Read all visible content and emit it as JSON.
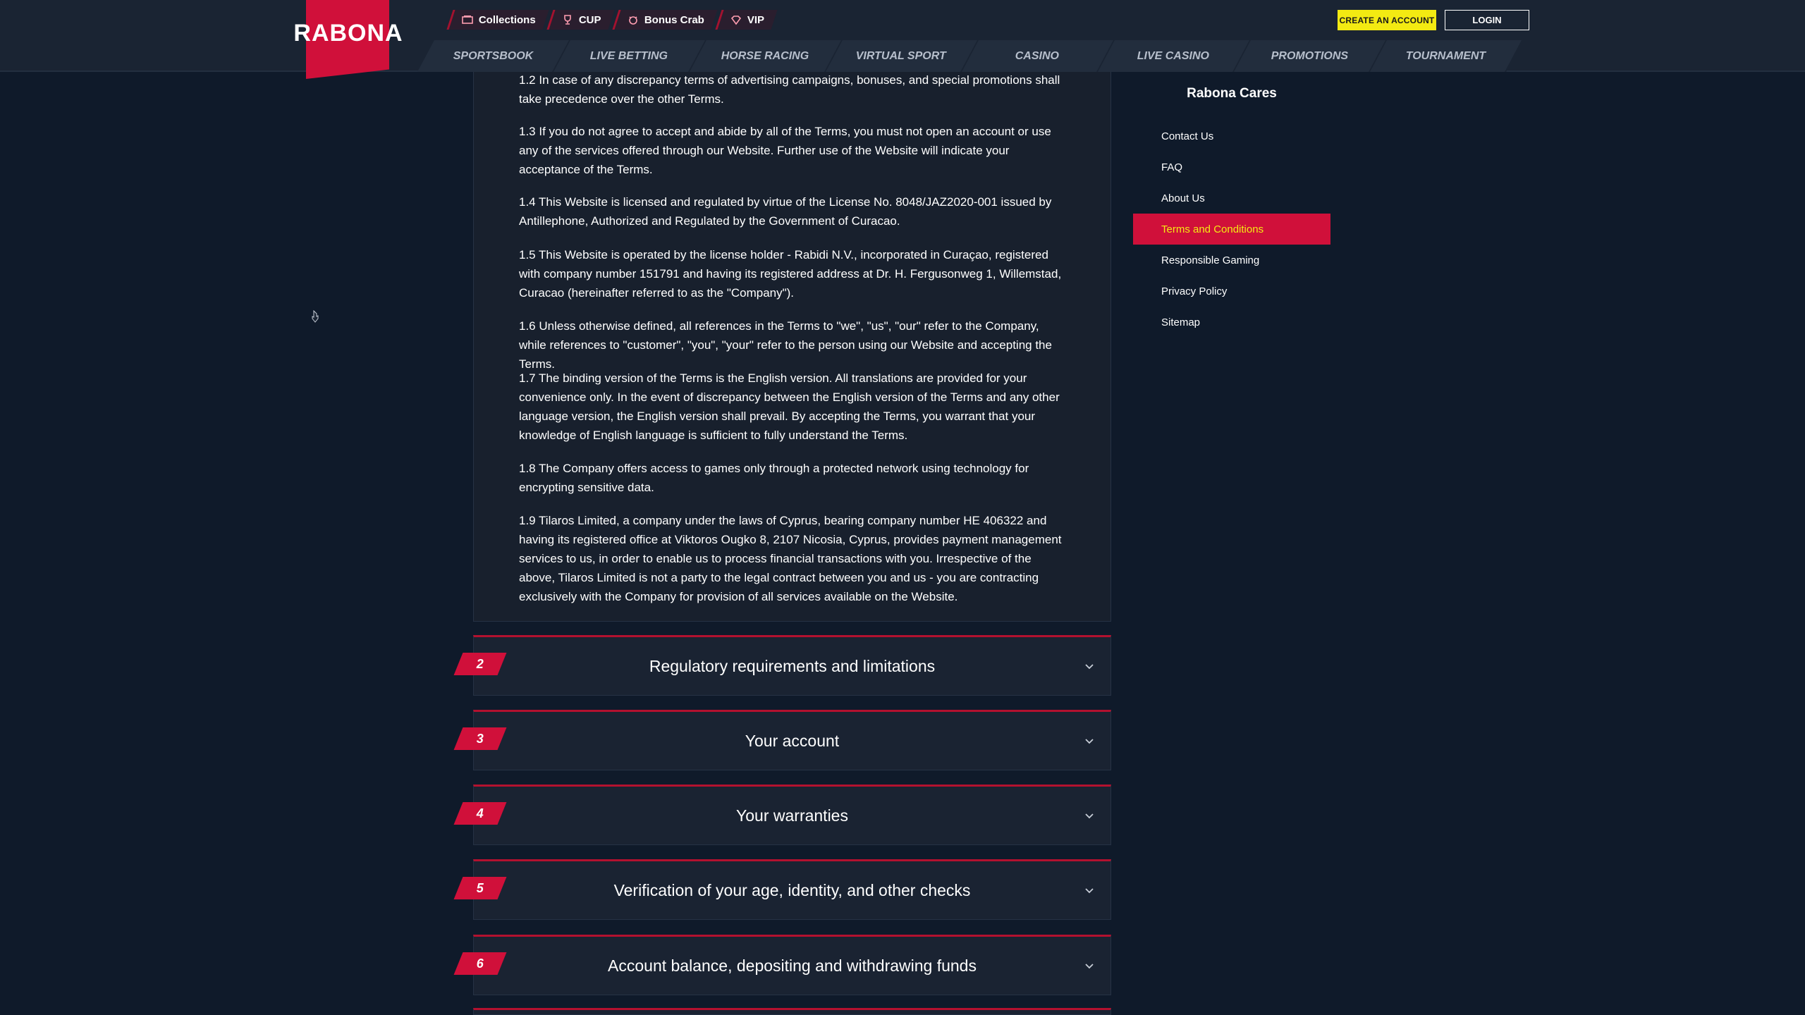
{
  "brand": {
    "logo_text": "RABONA"
  },
  "topnav": [
    {
      "label": "Collections",
      "icon": "collections-icon"
    },
    {
      "label": "CUP",
      "icon": "trophy-icon"
    },
    {
      "label": "Bonus Crab",
      "icon": "crab-icon"
    },
    {
      "label": "VIP",
      "icon": "diamond-icon"
    }
  ],
  "auth": {
    "create_label": "CREATE AN ACCOUNT",
    "login_label": "LOGIN"
  },
  "mainnav": [
    "SPORTSBOOK",
    "LIVE BETTING",
    "HORSE RACING",
    "VIRTUAL SPORT",
    "CASINO",
    "LIVE CASINO",
    "PROMOTIONS",
    "TOURNAMENT"
  ],
  "terms": {
    "paragraphs": [
      "1.2 In case of any discrepancy terms of advertising campaigns, bonuses, and special promotions shall take precedence over the other Terms.",
      "1.3 If you do not agree to accept and abide by all of the Terms, you must not open an account or use any of the services offered through our Website. Further use of the Website will indicate your acceptance of the Terms.",
      "1.4 This Website is licensed and regulated by virtue of the License No. 8048/JAZ2020-001 issued by Antillephone, Authorized and Regulated by the Government of Curacao.",
      "1.5 This Website is operated by the license holder - Rabidi N.V., incorporated in Curaçao, registered with company number 151791 and having its registered address at Dr. H. Fergusonweg 1, Willemstad, Curacao (hereinafter referred to as the \"Company\").",
      "1.6 Unless otherwise defined, all references in the Terms to \"we\", \"us\", \"our\" refer to the Company, while references to \"customer\", \"you\", \"your\" refer to the person using our Website and accepting the Terms.",
      "1.7 The binding version of the Terms is the English version. All translations are provided for your convenience only. In the event of discrepancy between the English version of the Terms and any other language version, the English version shall prevail. By accepting the Terms, you warrant that your knowledge of English language is sufficient to fully understand the Terms.",
      "1.8 The Company offers access to games only through a protected network using technology for encrypting sensitive data.",
      "1.9 Tilaros Limited, a company under the laws of Cyprus, bearing company number HE 406322 and having its registered office at Viktoros Ougko 8, 2107 Nicosia, Cyprus, provides payment management services to us, in order to enable us to process financial transactions with you. Irrespective of the above, Tilaros Limited is not a party to the legal contract between you and us - you are contracting exclusively with the Company for provision of all services available on the Website."
    ],
    "sections": [
      {
        "num": "2",
        "title": "Regulatory requirements and limitations"
      },
      {
        "num": "3",
        "title": "Your account"
      },
      {
        "num": "4",
        "title": "Your warranties"
      },
      {
        "num": "5",
        "title": "Verification of your age, identity, and other checks"
      },
      {
        "num": "6",
        "title": "Account balance, depositing and withdrawing funds"
      }
    ]
  },
  "sidebar": {
    "title": "Rabona Cares",
    "items": [
      "Contact Us",
      "FAQ",
      "About Us",
      "Terms and Conditions",
      "Responsible Gaming",
      "Privacy Policy",
      "Sitemap"
    ],
    "active_index": 3
  },
  "colors": {
    "accent": "#d0103a",
    "highlight": "#f3ea12",
    "background": "#0f1a2a",
    "header": "#1a2433"
  }
}
